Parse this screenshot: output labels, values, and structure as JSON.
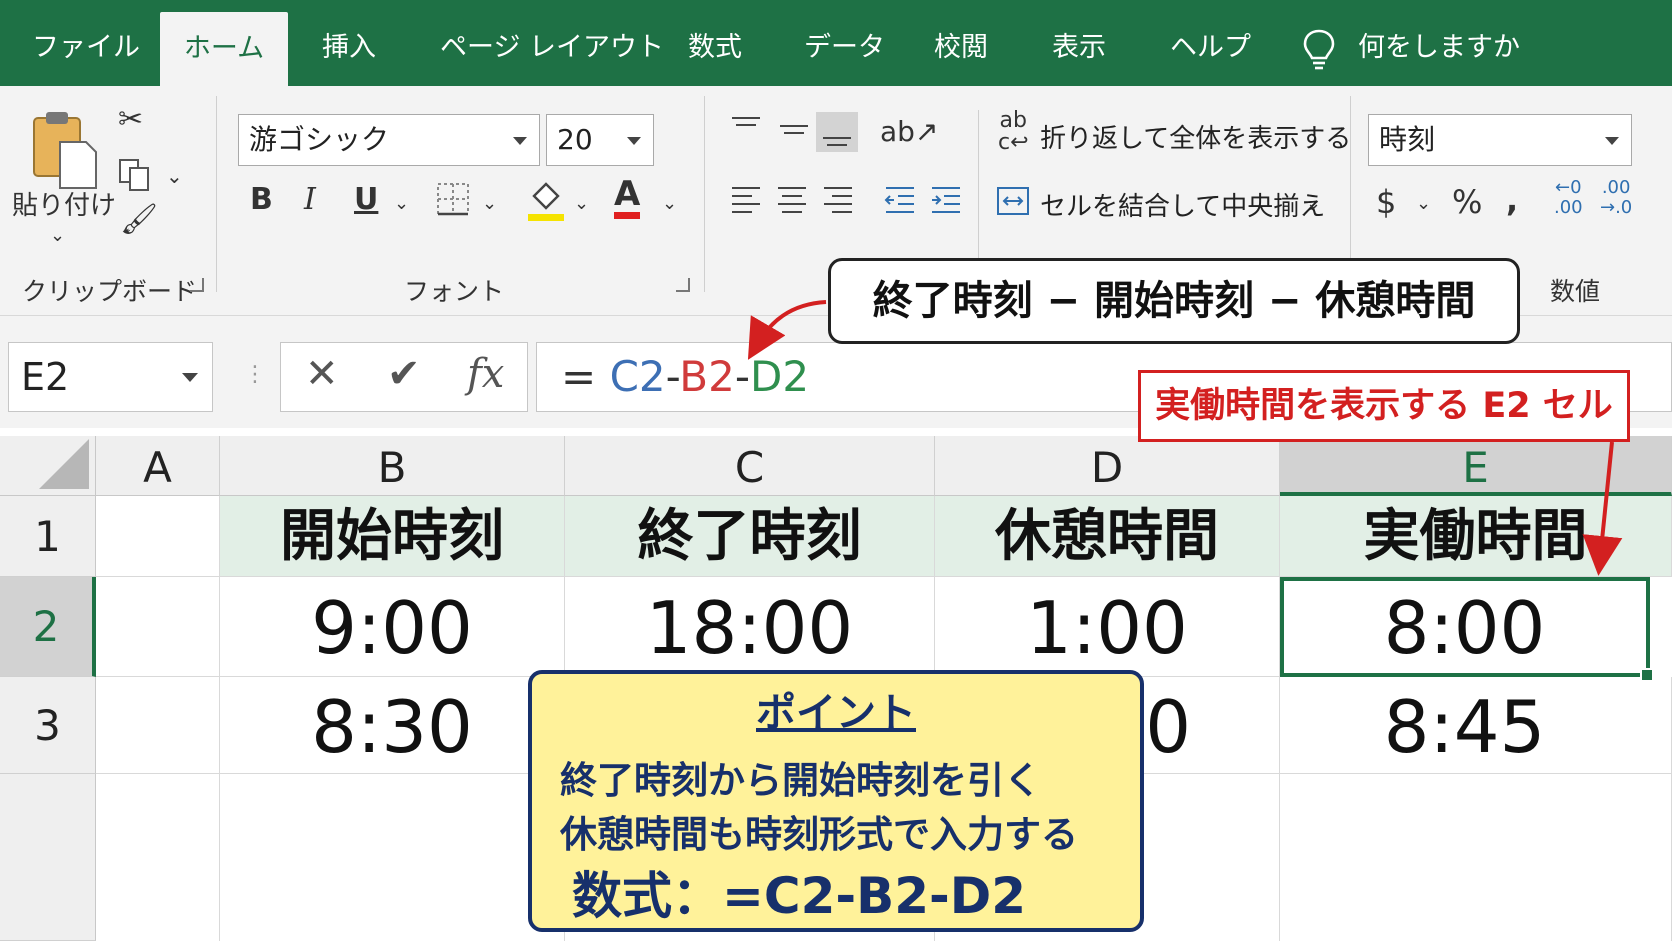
{
  "tabs": [
    "ファイル",
    "ホーム",
    "挿入",
    "ページ レイアウト",
    "数式",
    "データ",
    "校閲",
    "表示",
    "ヘルプ"
  ],
  "tell_me": "何をしますか",
  "ribbon": {
    "clipboard_label": "クリップボード",
    "paste_label": "貼り付け",
    "font_label": "フォント",
    "font_name": "游ゴシック",
    "font_size": "20",
    "bold": "B",
    "italic": "I",
    "underline": "U",
    "font_color_glyph": "A",
    "wrap_text": "折り返して全体を表示する",
    "merge_center": "セルを結合して中央揃え",
    "number_format": "時刻",
    "number_label": "数値",
    "currency": "$",
    "percent": "%",
    "comma": ","
  },
  "formula_bar": {
    "name_box": "E2",
    "fx": "fx",
    "formula_eq": "=",
    "formula_c2": "C2",
    "formula_dash1": "-",
    "formula_b2": "B2",
    "formula_dash2": "-",
    "formula_d2": "D2"
  },
  "columns": [
    "A",
    "B",
    "C",
    "D",
    "E"
  ],
  "rows": [
    "1",
    "2",
    "3"
  ],
  "table": {
    "headers": [
      "開始時刻",
      "終了時刻",
      "休憩時間",
      "実働時間"
    ],
    "row2": [
      "9:00",
      "18:00",
      "1:00",
      "8:00"
    ],
    "row3": [
      "8:30",
      "",
      "0",
      "8:45"
    ]
  },
  "callouts": {
    "formula_explain": "終了時刻 − 開始時刻 − 休憩時間",
    "e2_label": "実働時間を表示する E2 セル"
  },
  "point": {
    "title": "ポイント",
    "line1": "終了時刻から開始時刻を引く",
    "line2": "休憩時間も時刻形式で入力する",
    "formula": "数式：=C2-B2-D2"
  },
  "colors": {
    "excel_green": "#1e7145",
    "c2_color": "#3d6fb4",
    "b2_color": "#d03b3b",
    "d2_color": "#2f8f4e",
    "callout_red": "#d32020",
    "point_bg": "#fff29a",
    "point_border": "#17306b"
  }
}
